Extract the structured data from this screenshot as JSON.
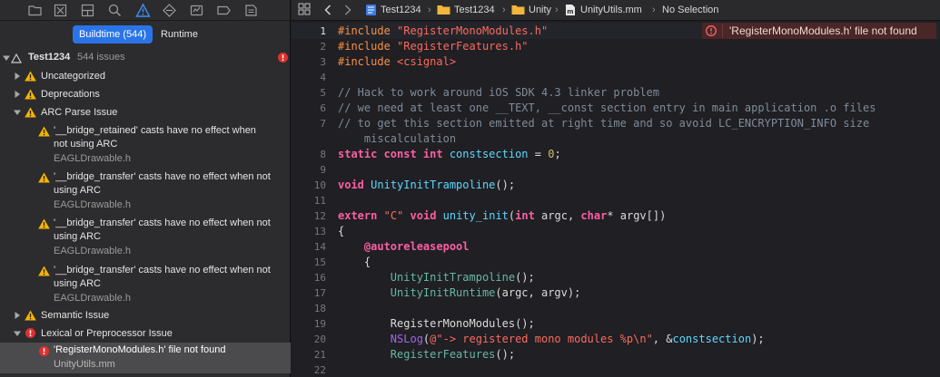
{
  "navigator": {
    "toolbar_icons": [
      "folder-icon",
      "source-control-icon",
      "symbol-icon",
      "find-icon",
      "issue-icon",
      "test-icon",
      "debug-icon",
      "breakpoint-icon",
      "report-icon"
    ],
    "segments": {
      "buildtime": "Buildtime (544)",
      "runtime": "Runtime"
    },
    "project": {
      "name": "Test1234",
      "count": "544 issues"
    },
    "groups": {
      "uncategorized": "Uncategorized",
      "deprecations": "Deprecations",
      "arc_parse": "ARC Parse Issue",
      "semantic": "Semantic Issue",
      "lexical": "Lexical or Preprocessor Issue"
    },
    "issues": [
      {
        "line1": "'__bridge_retained' casts have no effect when",
        "line2": "not using ARC",
        "file": "EAGLDrawable.h"
      },
      {
        "line1": "'__bridge_transfer' casts have no effect when not",
        "line2": "using ARC",
        "file": "EAGLDrawable.h"
      },
      {
        "line1": "'__bridge_transfer' casts have no effect when not",
        "line2": "using ARC",
        "file": "EAGLDrawable.h"
      },
      {
        "line1": "'__bridge_transfer' casts have no effect when not",
        "line2": "using ARC",
        "file": "EAGLDrawable.h"
      }
    ],
    "selected_issue": {
      "message": "'RegisterMonoModules.h' file not found",
      "file": "UnityUtils.mm"
    }
  },
  "jumpbar": {
    "crumbs": [
      "Test1234",
      "Test1234",
      "Unity",
      "UnityUtils.mm",
      "No Selection"
    ]
  },
  "editor": {
    "inline_error": "'RegisterMonoModules.h' file not found",
    "line_numbers": [
      "1",
      "2",
      "3",
      "4",
      "5",
      "6",
      "7",
      "",
      "8",
      "9",
      "10",
      "11",
      "12",
      "13",
      "14",
      "15",
      "16",
      "17",
      "18",
      "19",
      "20",
      "21",
      "22"
    ]
  },
  "colors": {
    "accent": "#2a74e8",
    "error": "#e0312f",
    "warning": "#f5b400"
  }
}
